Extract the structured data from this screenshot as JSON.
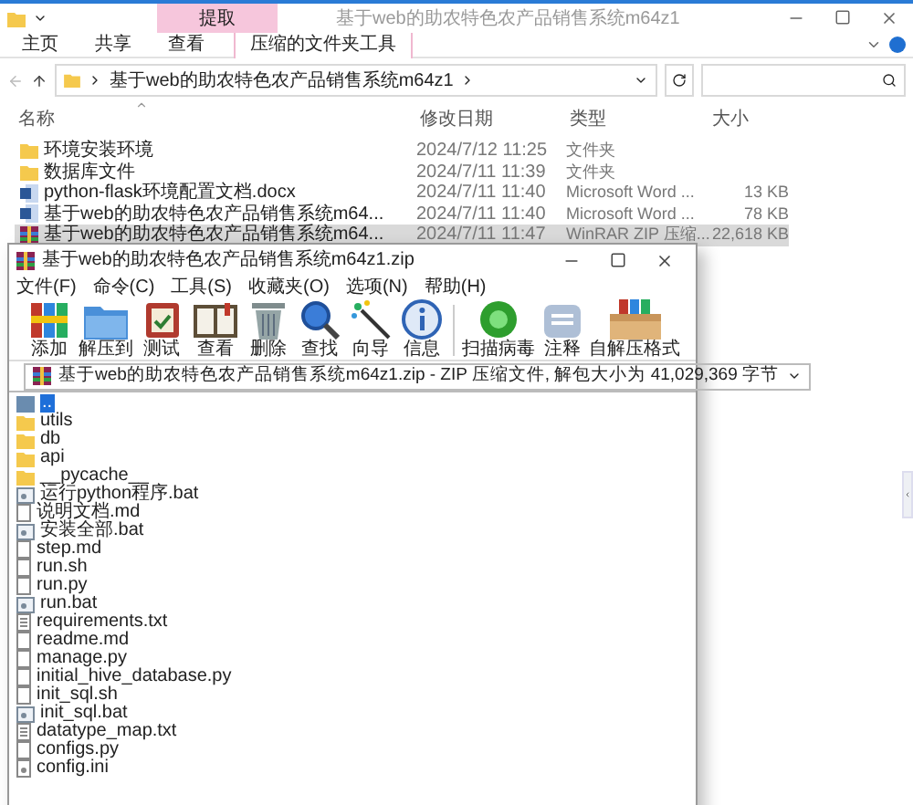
{
  "explorer": {
    "context_tab": "提取",
    "title": "基于web的助农特色农产品销售系统m64z1",
    "ribbon_tabs": [
      {
        "label": "主页",
        "selected": false
      },
      {
        "label": "共享",
        "selected": false
      },
      {
        "label": "查看",
        "selected": false
      },
      {
        "label": "压缩的文件夹工具",
        "selected": true
      }
    ],
    "address": "基于web的助农特色农产品销售系统m64z1",
    "columns": [
      "名称",
      "修改日期",
      "类型",
      "大小"
    ],
    "rows": [
      {
        "name": "环境安装环境",
        "date": "2024/7/12 11:25",
        "type": "文件夹",
        "size": "",
        "kind": "folder",
        "selected": false
      },
      {
        "name": "数据库文件",
        "date": "2024/7/11 11:39",
        "type": "文件夹",
        "size": "",
        "kind": "folder",
        "selected": false
      },
      {
        "name": "python-flask环境配置文档.docx",
        "date": "2024/7/11 11:40",
        "type": "Microsoft Word ...",
        "size": "13 KB",
        "kind": "word",
        "selected": false
      },
      {
        "name": "基于web的助农特色农产品销售系统m64...",
        "date": "2024/7/11 11:40",
        "type": "Microsoft Word ...",
        "size": "78 KB",
        "kind": "word",
        "selected": false
      },
      {
        "name": "基于web的助农特色农产品销售系统m64...",
        "date": "2024/7/11 11:47",
        "type": "WinRAR ZIP 压缩...",
        "size": "22,618 KB",
        "kind": "rar",
        "selected": true
      }
    ]
  },
  "winrar": {
    "title": "基于web的助农特色农产品销售系统m64z1.zip",
    "menu": [
      "文件(F)",
      "命令(C)",
      "工具(S)",
      "收藏夹(O)",
      "选项(N)",
      "帮助(H)"
    ],
    "toolbar": [
      {
        "label": "添加",
        "kind": "add"
      },
      {
        "label": "解压到",
        "kind": "extract"
      },
      {
        "label": "测试",
        "kind": "test"
      },
      {
        "label": "查看",
        "kind": "view"
      },
      {
        "label": "删除",
        "kind": "delete"
      },
      {
        "label": "查找",
        "kind": "find"
      },
      {
        "label": "向导",
        "kind": "wizard"
      },
      {
        "label": "信息",
        "kind": "info"
      },
      {
        "label": "扫描病毒",
        "kind": "scan"
      },
      {
        "label": "注释",
        "kind": "comment"
      },
      {
        "label": "自解压格式",
        "kind": "sfx"
      }
    ],
    "address": "基于web的助农特色农产品销售系统m64z1.zip - ZIP 压缩文件, 解包大小为 41,029,369 字节",
    "files": [
      {
        "name": "..",
        "kind": "up",
        "selected": true
      },
      {
        "name": "utils",
        "kind": "folder",
        "selected": false
      },
      {
        "name": "db",
        "kind": "folder",
        "selected": false
      },
      {
        "name": "api",
        "kind": "folder",
        "selected": false
      },
      {
        "name": "__pycache__",
        "kind": "folder",
        "selected": false
      },
      {
        "name": "运行python程序.bat",
        "kind": "bat",
        "selected": false
      },
      {
        "name": "说明文档.md",
        "kind": "file",
        "selected": false
      },
      {
        "name": "安装全部.bat",
        "kind": "bat",
        "selected": false
      },
      {
        "name": "step.md",
        "kind": "file",
        "selected": false
      },
      {
        "name": "run.sh",
        "kind": "file",
        "selected": false
      },
      {
        "name": "run.py",
        "kind": "file",
        "selected": false
      },
      {
        "name": "run.bat",
        "kind": "bat",
        "selected": false
      },
      {
        "name": "requirements.txt",
        "kind": "txt",
        "selected": false
      },
      {
        "name": "readme.md",
        "kind": "file",
        "selected": false
      },
      {
        "name": "manage.py",
        "kind": "file",
        "selected": false
      },
      {
        "name": "initial_hive_database.py",
        "kind": "file",
        "selected": false
      },
      {
        "name": "init_sql.sh",
        "kind": "file",
        "selected": false
      },
      {
        "name": "init_sql.bat",
        "kind": "bat",
        "selected": false
      },
      {
        "name": "datatype_map.txt",
        "kind": "txt",
        "selected": false
      },
      {
        "name": "configs.py",
        "kind": "file",
        "selected": false
      },
      {
        "name": "config.ini",
        "kind": "ini",
        "selected": false
      }
    ]
  }
}
